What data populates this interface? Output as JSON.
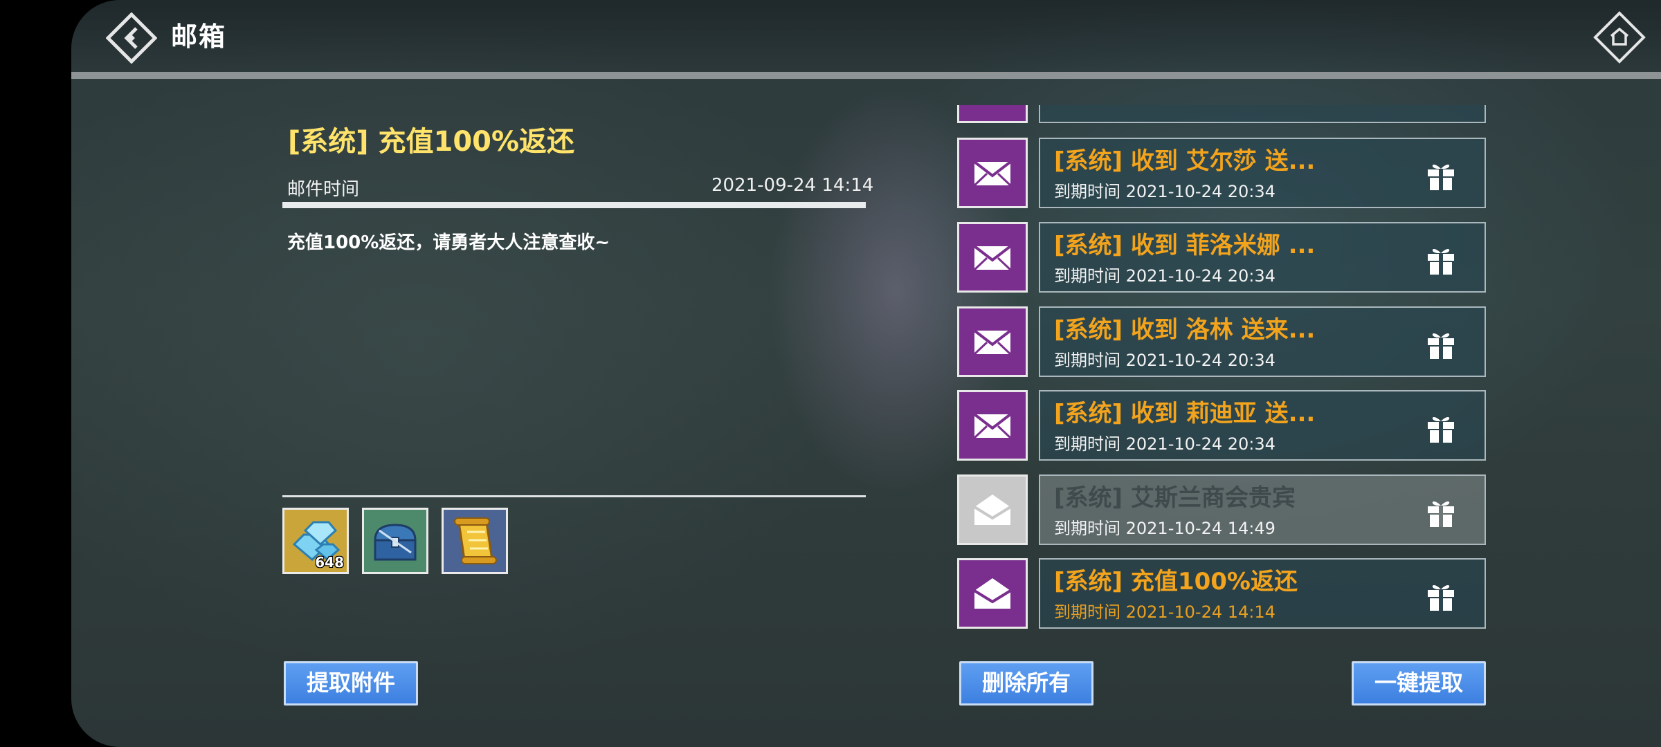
{
  "header": {
    "title": "邮箱"
  },
  "detail": {
    "title": "[系统] 充值100%返还",
    "time_label": "邮件时间",
    "time_value": "2021-09-24 14:14",
    "body": "充值100%返还，请勇者大人注意查收~"
  },
  "attachments": [
    {
      "icon": "diamond-icon",
      "count": "648",
      "bg": "#c9a53a"
    },
    {
      "icon": "chest-icon",
      "count": "",
      "bg": "#4d8a6c"
    },
    {
      "icon": "scroll-icon",
      "count": "",
      "bg": "#4b6494"
    }
  ],
  "mails": [
    {
      "title": "[系统] 收到 艾尔莎 送...",
      "expire": "到期时间 2021-10-24 20:34",
      "state": "unread"
    },
    {
      "title": "[系统] 收到 菲洛米娜 ...",
      "expire": "到期时间 2021-10-24 20:34",
      "state": "unread"
    },
    {
      "title": "[系统] 收到 洛林 送来...",
      "expire": "到期时间 2021-10-24 20:34",
      "state": "unread"
    },
    {
      "title": "[系统] 收到 莉迪亚 送...",
      "expire": "到期时间 2021-10-24 20:34",
      "state": "unread"
    },
    {
      "title": "[系统] 艾斯兰商会贵宾",
      "expire": "到期时间 2021-10-24 14:49",
      "state": "read"
    },
    {
      "title": "[系统] 充值100%返还",
      "expire": "到期时间 2021-10-24 14:14",
      "state": "selected"
    }
  ],
  "buttons": {
    "claim_attachment": "提取附件",
    "delete_all": "删除所有",
    "claim_all": "一键提取"
  },
  "colors": {
    "mail_icon_unread": "#7a2f8e",
    "mail_icon_read": "#c8c8c8",
    "title_unread": "#f3a41c",
    "title_read": "#3e4a4c",
    "detail_title": "#ffe36a",
    "button_blue": "#3d7fe0"
  }
}
